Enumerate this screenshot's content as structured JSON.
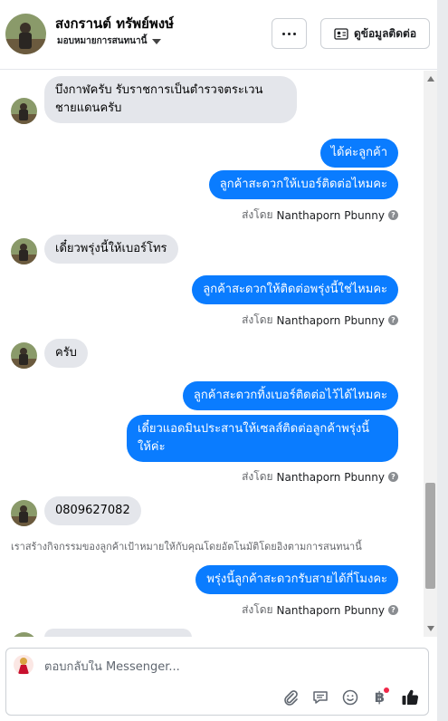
{
  "header": {
    "contact_name": "สงกรานต์ ทรัพย์พงษ์",
    "assign_label": "มอบหมายการสนทนานี้",
    "contact_info_label": "ดูข้อมูลติดต่อ"
  },
  "messages": {
    "m1": {
      "text_line1": "บึงกาฬครับ รับราชการเป็นตำรวจตระเวน",
      "text_line2": "ชายแดนครับ"
    },
    "m2": {
      "text": "ได้ค่ะลูกค้า"
    },
    "m3": {
      "text": "ลูกค้าสะดวกให้เบอร์ติดต่อไหมคะ"
    },
    "sent1": {
      "prefix": "ส่งโดย",
      "name": "Nanthaporn Pbunny"
    },
    "m4": {
      "text": "เดี๋ยวพรุ่งนี้ให้เบอร์โทร"
    },
    "m5": {
      "text": "ลูกค้าสะดวกให้ติดต่อพรุ่งนี้ใช่ไหมคะ"
    },
    "sent2": {
      "prefix": "ส่งโดย",
      "name": "Nanthaporn Pbunny"
    },
    "m6": {
      "text": "ครับ"
    },
    "m7": {
      "text": "ลูกค้าสะดวกทิ้งเบอร์ติดต่อไว้ได้ไหมคะ"
    },
    "m8": {
      "text_line1": "เดี๋ยวแอดมินประสานให้เซลส์ติดต่อลูกค้าพรุ่งนี้",
      "text_line2": "ให้ค่ะ"
    },
    "sent3": {
      "prefix": "ส่งโดย",
      "name": "Nanthaporn Pbunny"
    },
    "m9": {
      "text": "0809627082"
    },
    "system_note": "เราสร้างกิจกรรมของลูกค้าเป้าหมายให้กับคุณโดยอัตโนมัติโดยอิงตามการสนทนานี้",
    "m10": {
      "text": "พรุ่งนี้ลูกค้าสะดวกรับสายได้กี่โมงคะ"
    },
    "sent4": {
      "prefix": "ส่งโดย",
      "name": "Nanthaporn Pbunny"
    }
  },
  "composer": {
    "placeholder": "ตอบกลับใน Messenger...",
    "icons": [
      "paperclip-icon",
      "chat-bubble-icon",
      "emoji-icon",
      "baht-payment-icon",
      "thumbs-up-icon"
    ],
    "baht_symbol": "฿"
  },
  "colors": {
    "outgoing_bubble": "#0a7cff",
    "incoming_bubble": "#e4e6eb",
    "notification_dot": "#f02849"
  }
}
